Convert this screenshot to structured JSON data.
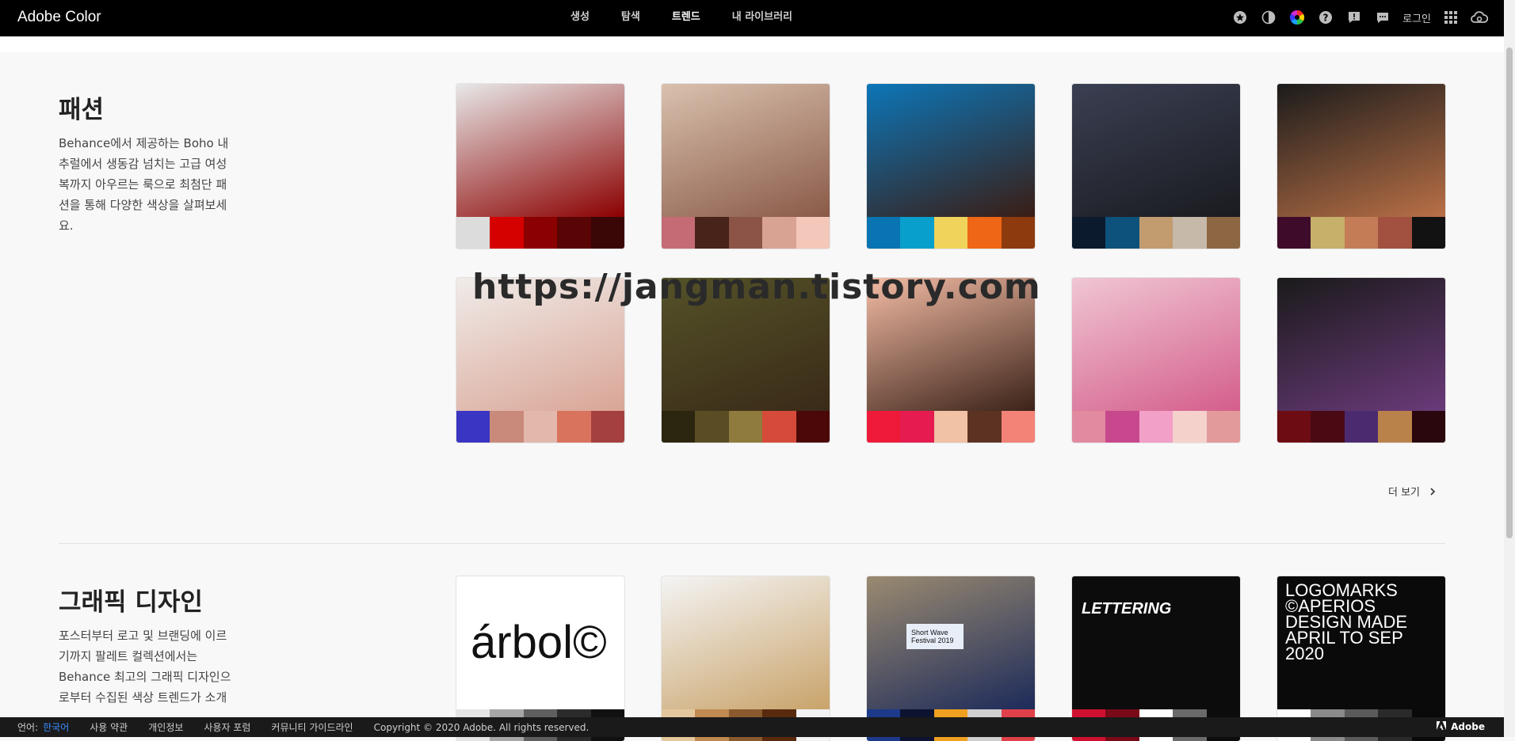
{
  "app": {
    "title": "Adobe Color"
  },
  "nav": [
    {
      "label": "생성",
      "active": false
    },
    {
      "label": "탐색",
      "active": false
    },
    {
      "label": "트렌드",
      "active": true
    },
    {
      "label": "내 라이브러리",
      "active": false
    }
  ],
  "toolbar": {
    "icons": [
      "star-icon",
      "contrast-icon",
      "color-wheel-icon",
      "help-icon",
      "alert-icon",
      "chat-icon",
      "apps-icon",
      "creative-cloud-icon"
    ],
    "login_label": "로그인"
  },
  "fashion": {
    "title": "패션",
    "description": "Behance에서 제공하는 Boho 내추럴에서 생동감 넘치는 고급 여성복까지 아우르는 룩으로 최첨단 패션을 통해 다양한 색상을 살펴보세요.",
    "more_label": "더 보기",
    "cards": [
      {
        "bg": [
          "#e8e8e8",
          "#8b0000"
        ],
        "swatches": [
          "#dcdcdc",
          "#d50000",
          "#8b0000",
          "#5a0505",
          "#3a0606"
        ]
      },
      {
        "bg": [
          "#d9c1ae",
          "#8a5a48"
        ],
        "swatches": [
          "#c56b76",
          "#47231a",
          "#8c5446",
          "#d9a394",
          "#f3c7b9"
        ]
      },
      {
        "bg": [
          "#0c76b8",
          "#3a1d14"
        ],
        "swatches": [
          "#0874b1",
          "#099fcc",
          "#f0d35a",
          "#ef6616",
          "#8c3a0e"
        ]
      },
      {
        "bg": [
          "#3a3f52",
          "#1a1b20"
        ],
        "swatches": [
          "#0b1a2c",
          "#0c527c",
          "#c29c6f",
          "#c6b9a9",
          "#8d6743"
        ]
      },
      {
        "bg": [
          "#1b1b1b",
          "#b97046"
        ],
        "swatches": [
          "#3e0c2a",
          "#c6b06a",
          "#c47c56",
          "#a2503f",
          "#121212"
        ]
      },
      {
        "bg": [
          "#f0ece9",
          "#d9a596"
        ],
        "swatches": [
          "#3a35c2",
          "#c98a7c",
          "#e1b8ab",
          "#d9735e",
          "#a54040"
        ]
      },
      {
        "bg": [
          "#545228",
          "#3a2a18"
        ],
        "swatches": [
          "#2c2610",
          "#5a4d24",
          "#8f7b3d",
          "#d64a3a",
          "#4c0808"
        ]
      },
      {
        "bg": [
          "#f2bba4",
          "#3b2218"
        ],
        "swatches": [
          "#ef1a3a",
          "#e61b4f",
          "#f1c2a3",
          "#5c3222",
          "#f38277"
        ]
      },
      {
        "bg": [
          "#f0c6d3",
          "#d45e8c"
        ],
        "swatches": [
          "#e18aa0",
          "#c7488d",
          "#f2a0c8",
          "#f5d1cc",
          "#e29a9a"
        ]
      },
      {
        "bg": [
          "#1a1a1a",
          "#6a3a7a"
        ],
        "swatches": [
          "#6d0c12",
          "#4a0a14",
          "#4b2a70",
          "#b9824a",
          "#2a070c"
        ]
      }
    ]
  },
  "graphic": {
    "title": "그래픽 디자인",
    "description": "포스터부터 로고 및 브랜딩에 이르기까지 팔레트 컬렉션에서는 Behance 최고의 그래픽 디자인으로부터 수집된 색상 트렌드가 소개",
    "cards": [
      {
        "bg": [
          "#ffffff",
          "#ffffff"
        ],
        "art_text": "árbol©",
        "swatches": [
          "#e5e5e5",
          "#a7a7a7",
          "#5f5f5f",
          "#2b2b2b",
          "#111111"
        ]
      },
      {
        "bg": [
          "#f4f4f4",
          "#c9a36a"
        ],
        "art_text": "",
        "swatches": [
          "#e4c79c",
          "#c08a50",
          "#8a5a2e",
          "#5a2a0e",
          "#f2f2f2"
        ]
      },
      {
        "bg": [
          "#9a8a70",
          "#1d2b5a"
        ],
        "art_text": "Short Wave Festival 2019",
        "swatches": [
          "#1d3a8a",
          "#0d1230",
          "#f0a020",
          "#cfcfcf",
          "#e0404a"
        ]
      },
      {
        "bg": [
          "#0c0c0c",
          "#0c0c0c"
        ],
        "art_text": "LETTERING",
        "swatches": [
          "#d01030",
          "#7a0a18",
          "#ffffff",
          "#6a6a6a",
          "#0c0c0c"
        ]
      },
      {
        "bg": [
          "#0a0a0a",
          "#0a0a0a"
        ],
        "art_text": "LOGOMARKS ©APERIOS DESIGN MADE APRIL TO SEP 2020",
        "swatches": [
          "#ffffff",
          "#8a8a8a",
          "#5a5a5a",
          "#2a2a2a",
          "#0a0a0a"
        ]
      }
    ]
  },
  "watermark": "https://jangman.tistory.com",
  "footer": {
    "language_label": "언어:",
    "language_value": "한국어",
    "links": [
      "사용 약관",
      "개인정보",
      "사용자 포럼",
      "커뮤니티 가이드라인"
    ],
    "copyright": "Copyright © 2020 Adobe. All rights reserved.",
    "brand": "Adobe"
  }
}
